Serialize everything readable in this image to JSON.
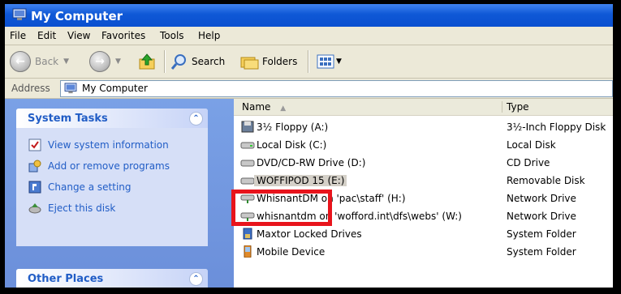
{
  "window": {
    "title": "My Computer",
    "title_icon": "computer-icon"
  },
  "menu": [
    "File",
    "Edit",
    "View",
    "Favorites",
    "Tools",
    "Help"
  ],
  "toolbar": {
    "back_label": "Back",
    "search_label": "Search",
    "folders_label": "Folders"
  },
  "address": {
    "label": "Address",
    "value": "My Computer"
  },
  "system_tasks": {
    "title": "System Tasks",
    "items": [
      "View system information",
      "Add or remove programs",
      "Change a setting",
      "Eject this disk"
    ]
  },
  "other_places": {
    "title": "Other Places"
  },
  "columns": {
    "name": "Name",
    "type": "Type"
  },
  "files": [
    {
      "name": "3½ Floppy (A:)",
      "type": "3½-Inch Floppy Disk",
      "icon": "floppy-icon"
    },
    {
      "name": "Local Disk (C:)",
      "type": "Local Disk",
      "icon": "hard-drive-icon"
    },
    {
      "name": "DVD/CD-RW Drive (D:)",
      "type": "CD Drive",
      "icon": "cd-drive-icon"
    },
    {
      "name": "WOFFIPOD 15 (E:)",
      "type": "Removable Disk",
      "icon": "removable-disk-icon"
    },
    {
      "name": "WhisnantDM on 'pac\\staff' (H:)",
      "type": "Network Drive",
      "icon": "network-drive-icon"
    },
    {
      "name": "whisnantdm on 'wofford.int\\dfs\\webs' (W:)",
      "type": "Network Drive",
      "icon": "network-drive-icon"
    },
    {
      "name": "Maxtor Locked Drives",
      "type": "System Folder",
      "icon": "system-folder-icon"
    },
    {
      "name": "Mobile Device",
      "type": "System Folder",
      "icon": "mobile-device-icon"
    }
  ],
  "selected_file": "WOFFIPOD 15 (E:)",
  "colors": {
    "title_blue": "#0f58d6",
    "task_link": "#215dc6",
    "highlight_red": "#e8141c"
  }
}
